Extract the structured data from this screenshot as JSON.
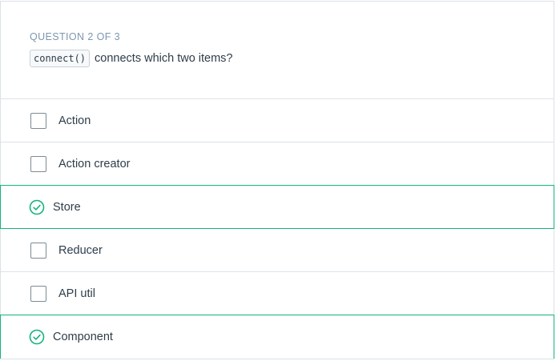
{
  "quiz": {
    "progress_label": "QUESTION 2 OF 3",
    "question_code": "connect()",
    "question_text": "connects which two items?",
    "options": [
      {
        "label": "Action",
        "correct": false
      },
      {
        "label": "Action creator",
        "correct": false
      },
      {
        "label": "Store",
        "correct": true
      },
      {
        "label": "Reducer",
        "correct": false
      },
      {
        "label": "API util",
        "correct": false
      },
      {
        "label": "Component",
        "correct": true
      }
    ]
  },
  "colors": {
    "correct": "#15b37a",
    "border": "#dbe2e8",
    "muted_text": "#7d97ad",
    "text": "#2e3d49"
  },
  "icons": {
    "correct": "check-circle-icon",
    "unchecked": "checkbox-icon"
  }
}
